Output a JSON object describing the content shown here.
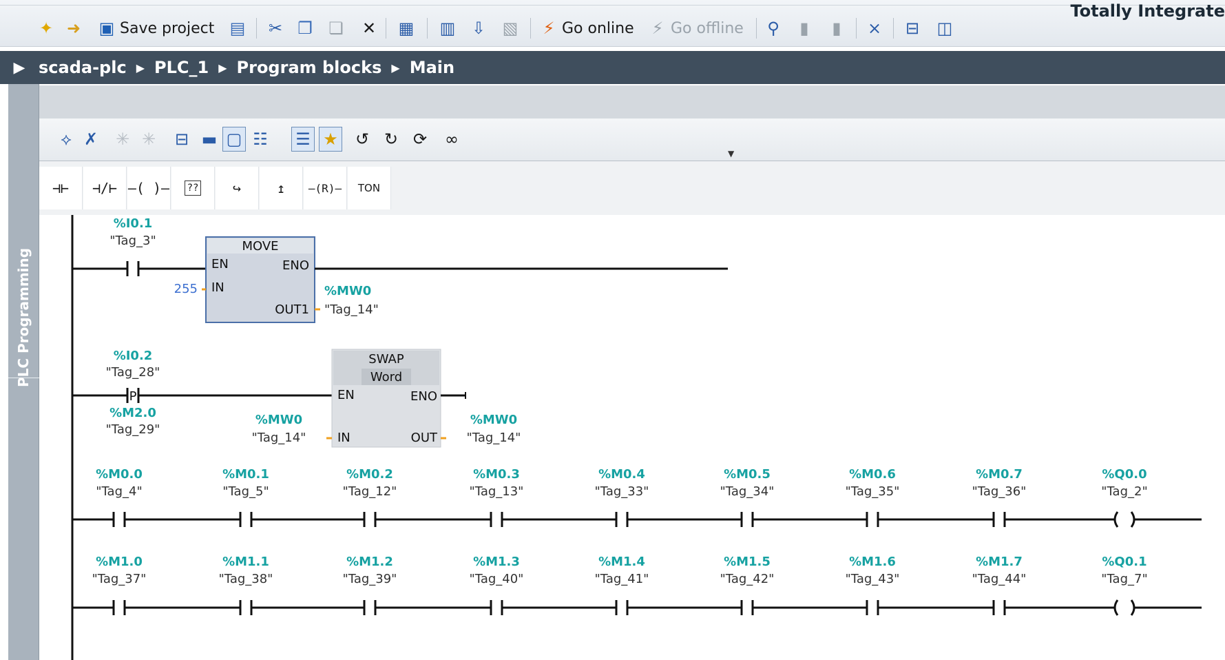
{
  "app": {
    "brand": "Totally Integrate"
  },
  "toolbar": {
    "save_label": "Save project",
    "go_online_label": "Go online",
    "go_offline_label": "Go offline"
  },
  "breadcrumb": [
    "scada-plc",
    "PLC_1",
    "Program blocks",
    "Main"
  ],
  "sidebar": {
    "title": "PLC Programming"
  },
  "instructions": [
    "contact-no",
    "contact-nc",
    "coil",
    "empty-box",
    "open-branch",
    "close-branch",
    "reset-coil",
    "TON"
  ],
  "instruction_labels": {
    "ton": "TON",
    "box": "??",
    "reset": "R"
  },
  "networks": {
    "n1": {
      "contact_addr": "%I0.1",
      "contact_tag": "\"Tag_3\"",
      "block": "MOVE",
      "pins": {
        "en": "EN",
        "eno": "ENO",
        "in": "IN",
        "out": "OUT1"
      },
      "in_value": "255",
      "out_addr": "%MW0",
      "out_tag": "\"Tag_14\""
    },
    "n2": {
      "contact_addr": "%I0.2",
      "contact_tag": "\"Tag_28\"",
      "contact_symbol": "P",
      "mem_addr": "%M2.0",
      "mem_tag": "\"Tag_29\"",
      "block": "SWAP",
      "block_type": "Word",
      "pins": {
        "en": "EN",
        "eno": "ENO",
        "in": "IN",
        "out": "OUT"
      },
      "in_addr": "%MW0",
      "in_tag": "\"Tag_14\"",
      "out_addr": "%MW0",
      "out_tag": "\"Tag_14\""
    },
    "n3": {
      "contacts": [
        {
          "addr": "%M0.0",
          "tag": "\"Tag_4\""
        },
        {
          "addr": "%M0.1",
          "tag": "\"Tag_5\""
        },
        {
          "addr": "%M0.2",
          "tag": "\"Tag_12\""
        },
        {
          "addr": "%M0.3",
          "tag": "\"Tag_13\""
        },
        {
          "addr": "%M0.4",
          "tag": "\"Tag_33\""
        },
        {
          "addr": "%M0.5",
          "tag": "\"Tag_34\""
        },
        {
          "addr": "%M0.6",
          "tag": "\"Tag_35\""
        },
        {
          "addr": "%M0.7",
          "tag": "\"Tag_36\""
        }
      ],
      "coil": {
        "addr": "%Q0.0",
        "tag": "\"Tag_2\""
      }
    },
    "n4": {
      "contacts": [
        {
          "addr": "%M1.0",
          "tag": "\"Tag_37\""
        },
        {
          "addr": "%M1.1",
          "tag": "\"Tag_38\""
        },
        {
          "addr": "%M1.2",
          "tag": "\"Tag_39\""
        },
        {
          "addr": "%M1.3",
          "tag": "\"Tag_40\""
        },
        {
          "addr": "%M1.4",
          "tag": "\"Tag_41\""
        },
        {
          "addr": "%M1.5",
          "tag": "\"Tag_42\""
        },
        {
          "addr": "%M1.6",
          "tag": "\"Tag_43\""
        },
        {
          "addr": "%M1.7",
          "tag": "\"Tag_44\""
        }
      ],
      "coil": {
        "addr": "%Q0.1",
        "tag": "\"Tag_7\""
      }
    }
  },
  "colors": {
    "address": "#17a2a2",
    "constant": "#3c6fd0",
    "wire_stub": "#f0a020",
    "breadcrumb_bg": "#3f4e5d"
  }
}
